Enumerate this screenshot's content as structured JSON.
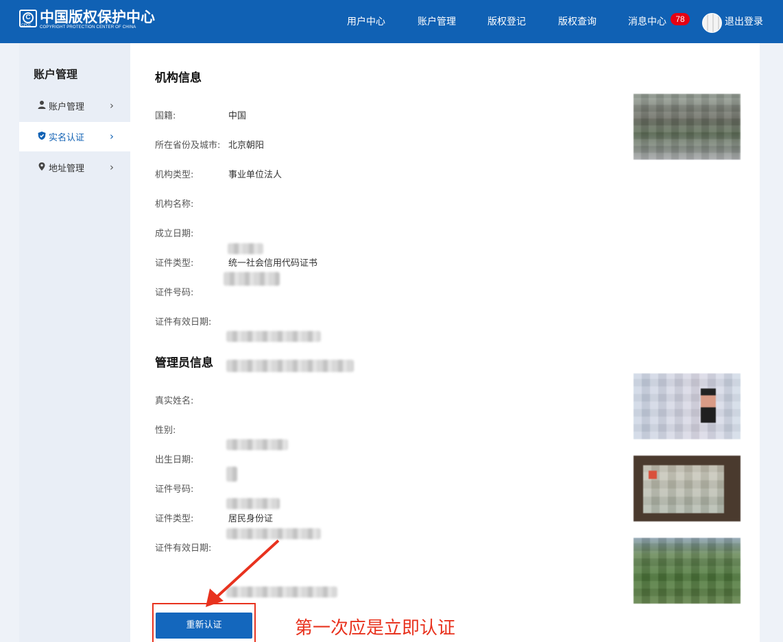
{
  "header": {
    "logo_cn": "中国版权保护中心",
    "logo_en": "COPYRIGHT PROTECTION CENTER OF CHINA",
    "logo_mark": "CPCC",
    "nav": [
      "用户中心",
      "账户管理",
      "版权登记",
      "版权查询",
      "消息中心"
    ],
    "message_badge": "78",
    "logout": "退出登录"
  },
  "sidebar": {
    "title": "账户管理",
    "items": [
      {
        "label": "账户管理",
        "icon": "user-icon"
      },
      {
        "label": "实名认证",
        "icon": "shield-icon"
      },
      {
        "label": "地址管理",
        "icon": "location-pin-icon"
      }
    ]
  },
  "org": {
    "title": "机构信息",
    "fields": [
      {
        "label": "国籍:",
        "value": "中国"
      },
      {
        "label": "所在省份及城市:",
        "value": "北京朝阳"
      },
      {
        "label": "机构类型:",
        "value": "事业单位法人"
      },
      {
        "label": "机构名称:",
        "value": ""
      },
      {
        "label": "成立日期:",
        "value": ""
      },
      {
        "label": "证件类型:",
        "value": "统一社会信用代码证书"
      },
      {
        "label": "证件号码:",
        "value": ""
      },
      {
        "label": "证件有效日期:",
        "value": ""
      }
    ]
  },
  "admin": {
    "title": "管理员信息",
    "fields": [
      {
        "label": "真实姓名:",
        "value": ""
      },
      {
        "label": "性别:",
        "value": ""
      },
      {
        "label": "出生日期:",
        "value": ""
      },
      {
        "label": "证件号码:",
        "value": ""
      },
      {
        "label": "证件类型:",
        "value": "居民身份证"
      },
      {
        "label": "证件有效日期:",
        "value": ""
      }
    ]
  },
  "actions": {
    "reauth": "重新认证"
  },
  "annotation": {
    "note": "第一次应是立即认证",
    "color": "#e8321e"
  },
  "colors": {
    "brand": "#1061b4",
    "badge": "#e60012"
  }
}
